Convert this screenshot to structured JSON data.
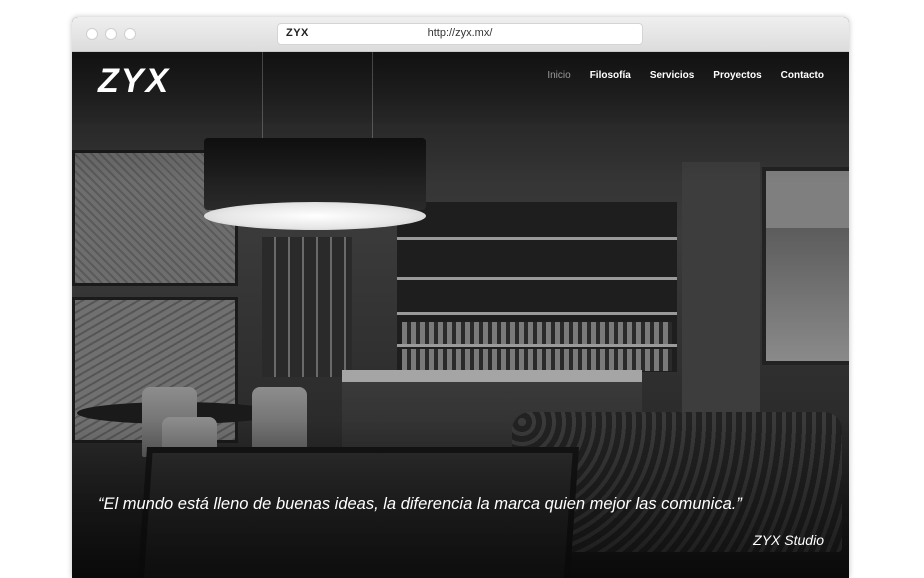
{
  "browser": {
    "favicon_text": "ZYX",
    "url": "http://zyx.mx/"
  },
  "site": {
    "logo_text": "ZYX",
    "nav": [
      {
        "label": "Inicio",
        "active": true
      },
      {
        "label": "Filosofía",
        "active": false
      },
      {
        "label": "Servicios",
        "active": false
      },
      {
        "label": "Proyectos",
        "active": false
      },
      {
        "label": "Contacto",
        "active": false
      }
    ],
    "quote": "“El mundo está lleno de buenas ideas, la diferencia la marca quien mejor las comunica.”",
    "signature": "ZYX Studio"
  },
  "icons": {
    "window_controls": [
      "close-dot",
      "minimize-dot",
      "maximize-dot"
    ]
  },
  "colors": {
    "nav_text": "#ffffff",
    "nav_active": "#9a9a9a",
    "hero_tone": "grayscale"
  }
}
